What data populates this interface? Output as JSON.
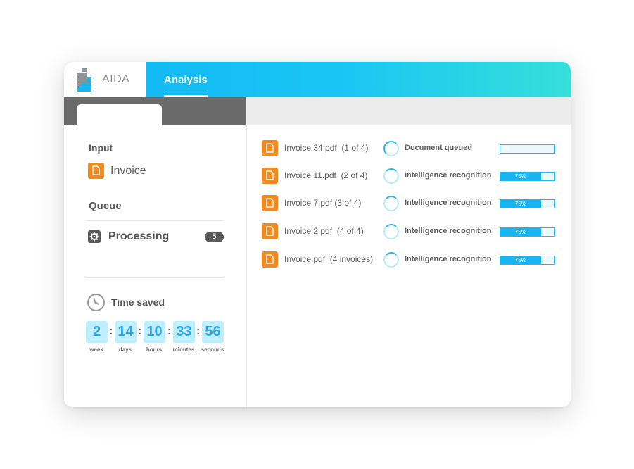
{
  "app": {
    "logo_text": "AIDA",
    "active_tab": "Analysis"
  },
  "colors": {
    "accent": "#17b4ef",
    "file_icon": "#f18a1f",
    "header_gradient_start": "#10b5f5",
    "header_gradient_end": "#36dfda"
  },
  "left_panel": {
    "input_title": "Input",
    "input_item": {
      "icon": "file-icon",
      "label": "Invoice"
    },
    "queue_title": "Queue",
    "queue_item": {
      "icon": "gear-icon",
      "label": "Processing",
      "count": "5"
    },
    "time_saved": {
      "icon": "clock-icon",
      "label": "Time saved",
      "units": [
        {
          "value": "2",
          "unit": "week"
        },
        {
          "value": "14",
          "unit": "days"
        },
        {
          "value": "10",
          "unit": "hours"
        },
        {
          "value": "33",
          "unit": "minutes"
        },
        {
          "value": "56",
          "unit": "seconds"
        }
      ],
      "separator": ":"
    }
  },
  "documents": [
    {
      "name": "Invoice 34.pdf  (1 of 4)",
      "status": "Document queued",
      "progress": 0,
      "progress_label": "0%"
    },
    {
      "name": "Invoice 11.pdf  (2 of 4)",
      "status": "Intelligence recognition",
      "progress": 75,
      "progress_label": "75%"
    },
    {
      "name": "Invoice 7.pdf (3 of 4)",
      "status": "Intelligence recognition",
      "progress": 75,
      "progress_label": "75%"
    },
    {
      "name": "Invoice 2.pdf  (4 of 4)",
      "status": "Intelligence recognition",
      "progress": 75,
      "progress_label": "75%"
    },
    {
      "name": "Invoice.pdf  (4 invoices)",
      "status": "Intelligence recognition",
      "progress": 75,
      "progress_label": "75%"
    }
  ]
}
